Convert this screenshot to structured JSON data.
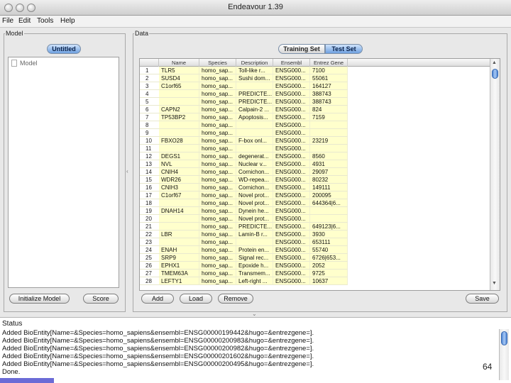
{
  "window": {
    "title": "Endeavour 1.39"
  },
  "menubar": {
    "items": [
      "File",
      "Edit",
      "Tools",
      "Help"
    ]
  },
  "model_panel": {
    "group_label": "Model",
    "tab": "Untitled",
    "tree_item": "Model",
    "buttons": {
      "initialize": "Initialize Model",
      "score": "Score"
    }
  },
  "data_panel": {
    "group_label": "Data",
    "tabs": {
      "training": "Training Set",
      "test": "Test Set",
      "selected": "Test Set"
    },
    "columns": [
      "Name",
      "Species",
      "Description",
      "Ensembl",
      "Entrez Gene"
    ],
    "rows": [
      {
        "n": "1",
        "name": "TLR5",
        "species": "homo_sap...",
        "desc": "Toll-like r...",
        "ens": "ENSG000...",
        "entrez": "7100"
      },
      {
        "n": "2",
        "name": "SUSD4",
        "species": "homo_sap...",
        "desc": "Sushi dom...",
        "ens": "ENSG000...",
        "entrez": "55061"
      },
      {
        "n": "3",
        "name": "C1orf65",
        "species": "homo_sap...",
        "desc": "",
        "ens": "ENSG000...",
        "entrez": "164127"
      },
      {
        "n": "4",
        "name": "",
        "species": "homo_sap...",
        "desc": "PREDICTE...",
        "ens": "ENSG000...",
        "entrez": "388743"
      },
      {
        "n": "5",
        "name": "",
        "species": "homo_sap...",
        "desc": "PREDICTE...",
        "ens": "ENSG000...",
        "entrez": "388743"
      },
      {
        "n": "6",
        "name": "CAPN2",
        "species": "homo_sap...",
        "desc": "Calpain-2 ...",
        "ens": "ENSG000...",
        "entrez": "824"
      },
      {
        "n": "7",
        "name": "TP53BP2",
        "species": "homo_sap...",
        "desc": "Apoptosis...",
        "ens": "ENSG000...",
        "entrez": "7159"
      },
      {
        "n": "8",
        "name": "",
        "species": "homo_sap...",
        "desc": "",
        "ens": "ENSG000...",
        "entrez": ""
      },
      {
        "n": "9",
        "name": "",
        "species": "homo_sap...",
        "desc": "",
        "ens": "ENSG000...",
        "entrez": ""
      },
      {
        "n": "10",
        "name": "FBXO28",
        "species": "homo_sap...",
        "desc": "F-box onl...",
        "ens": "ENSG000...",
        "entrez": "23219"
      },
      {
        "n": "11",
        "name": "",
        "species": "homo_sap...",
        "desc": "",
        "ens": "ENSG000...",
        "entrez": ""
      },
      {
        "n": "12",
        "name": "DEGS1",
        "species": "homo_sap...",
        "desc": "degenerat...",
        "ens": "ENSG000...",
        "entrez": "8560"
      },
      {
        "n": "13",
        "name": "NVL",
        "species": "homo_sap...",
        "desc": "Nuclear v...",
        "ens": "ENSG000...",
        "entrez": "4931"
      },
      {
        "n": "14",
        "name": "CNIH4",
        "species": "homo_sap...",
        "desc": "Cornichon...",
        "ens": "ENSG000...",
        "entrez": "29097"
      },
      {
        "n": "15",
        "name": "WDR26",
        "species": "homo_sap...",
        "desc": "WD-repea...",
        "ens": "ENSG000...",
        "entrez": "80232"
      },
      {
        "n": "16",
        "name": "CNIH3",
        "species": "homo_sap...",
        "desc": "Cornichon...",
        "ens": "ENSG000...",
        "entrez": "149111"
      },
      {
        "n": "17",
        "name": "C1orf67",
        "species": "homo_sap...",
        "desc": "Novel prot...",
        "ens": "ENSG000...",
        "entrez": "200095"
      },
      {
        "n": "18",
        "name": "",
        "species": "homo_sap...",
        "desc": "Novel prot...",
        "ens": "ENSG000...",
        "entrez": "644364|6..."
      },
      {
        "n": "19",
        "name": "DNAH14",
        "species": "homo_sap...",
        "desc": "Dynein he...",
        "ens": "ENSG000...",
        "entrez": ""
      },
      {
        "n": "20",
        "name": "",
        "species": "homo_sap...",
        "desc": "Novel prot...",
        "ens": "ENSG000...",
        "entrez": ""
      },
      {
        "n": "21",
        "name": "",
        "species": "homo_sap...",
        "desc": "PREDICTE...",
        "ens": "ENSG000...",
        "entrez": "649123|6..."
      },
      {
        "n": "22",
        "name": "LBR",
        "species": "homo_sap...",
        "desc": "Lamin-B r...",
        "ens": "ENSG000...",
        "entrez": "3930"
      },
      {
        "n": "23",
        "name": "",
        "species": "homo_sap...",
        "desc": "",
        "ens": "ENSG000...",
        "entrez": "653111"
      },
      {
        "n": "24",
        "name": "ENAH",
        "species": "homo_sap...",
        "desc": "Protein en...",
        "ens": "ENSG000...",
        "entrez": "55740"
      },
      {
        "n": "25",
        "name": "SRP9",
        "species": "homo_sap...",
        "desc": "Signal rec...",
        "ens": "ENSG000...",
        "entrez": "6726|653..."
      },
      {
        "n": "26",
        "name": "EPHX1",
        "species": "homo_sap...",
        "desc": "Epoxide h...",
        "ens": "ENSG000...",
        "entrez": "2052"
      },
      {
        "n": "27",
        "name": "TMEM63A",
        "species": "homo_sap...",
        "desc": "Transmem...",
        "ens": "ENSG000...",
        "entrez": "9725"
      },
      {
        "n": "28",
        "name": "LEFTY1",
        "species": "homo_sap...",
        "desc": "Left-right ...",
        "ens": "ENSG000...",
        "entrez": "10637"
      }
    ],
    "buttons": {
      "add": "Add",
      "load": "Load",
      "remove": "Remove",
      "save": "Save"
    }
  },
  "status": {
    "title": "Status",
    "lines": [
      "Added BioEntity[Name=&Species=homo_sapiens&ensembl=ENSG00000199442&hugo=&entrezgene=].",
      "Added BioEntity[Name=&Species=homo_sapiens&ensembl=ENSG00000200983&hugo=&entrezgene=].",
      "Added BioEntity[Name=&Species=homo_sapiens&ensembl=ENSG00000200982&hugo=&entrezgene=].",
      "Added BioEntity[Name=&Species=homo_sapiens&ensembl=ENSG00000201602&hugo=&entrezgene=].",
      "Added BioEntity[Name=&Species=homo_sapiens&ensembl=ENSG00000200495&hugo=&entrezgene=].",
      "Done."
    ],
    "page_number": "64"
  },
  "colors": {
    "selection_blue": "#6fa1e0",
    "row_yellow": "#ffffcc"
  }
}
